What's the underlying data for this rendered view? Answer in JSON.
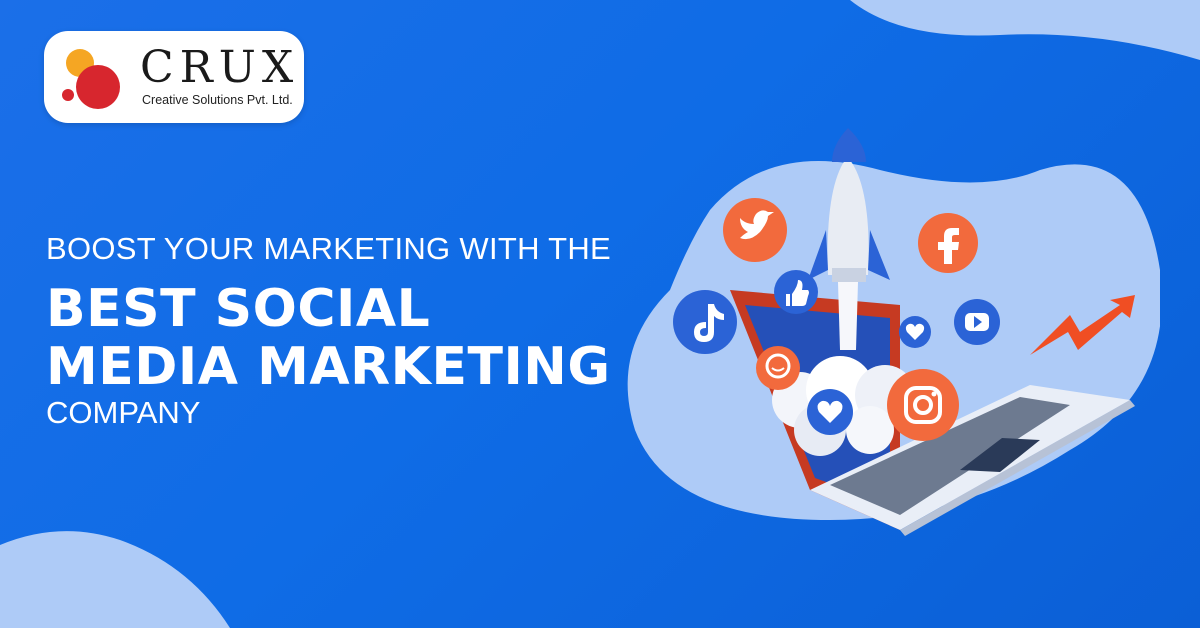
{
  "brand": {
    "name": "CRUX",
    "tagline": "Creative Solutions Pvt. Ltd.",
    "colors": {
      "orange": "#f5a623",
      "red": "#d7262e"
    }
  },
  "headline": {
    "line1": "BOOST YOUR MARKETING WITH THE",
    "line2": "BEST SOCIAL",
    "line3": "MEDIA MARKETING",
    "line4": "COMPANY"
  },
  "illustration": {
    "icons": [
      "twitter-icon",
      "facebook-icon",
      "like-icon",
      "tiktok-icon",
      "heart-icon",
      "youtube-icon",
      "chat-icon",
      "instagram-icon",
      "growth-arrow-icon",
      "rocket-icon",
      "laptop-icon"
    ]
  },
  "colors": {
    "background": "#0f6ce6",
    "blob": "#aecbf7",
    "accent": "#f04e23"
  }
}
